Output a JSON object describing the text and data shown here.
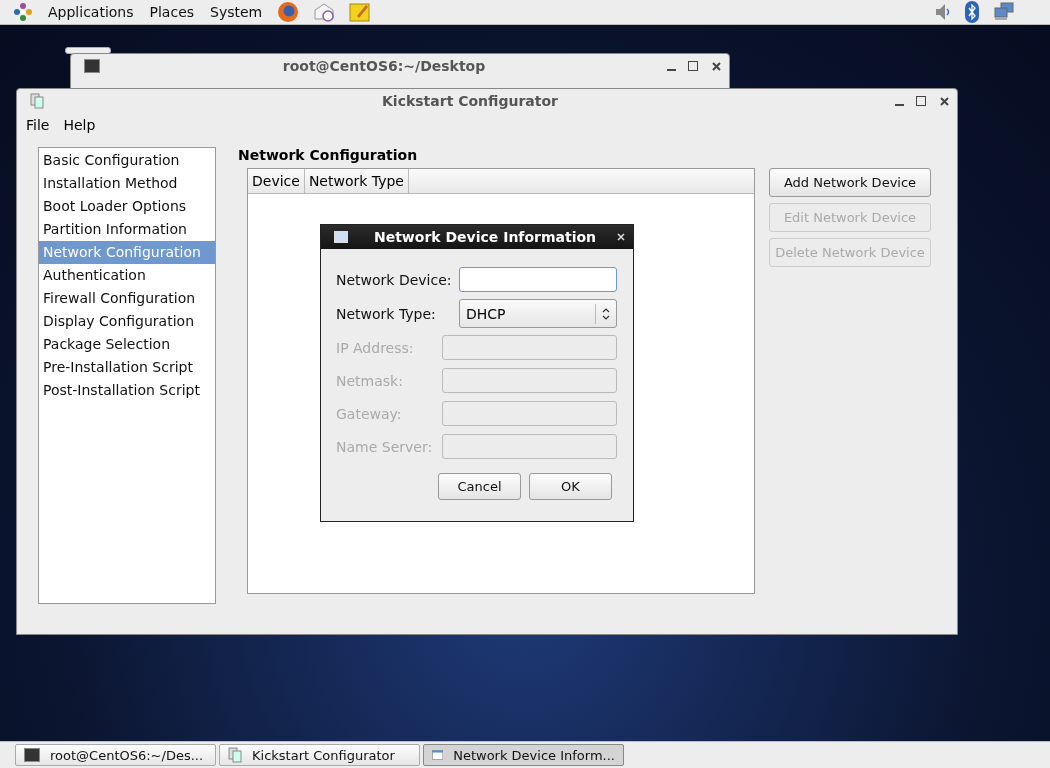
{
  "top_panel": {
    "menus": [
      "Applications",
      "Places",
      "System"
    ]
  },
  "terminal_window": {
    "title": "root@CentOS6:~/Desktop"
  },
  "main_window": {
    "title": "Kickstart Configurator",
    "menu": [
      "File",
      "Help"
    ],
    "sidebar": {
      "items": [
        {
          "label": "Basic Configuration",
          "selected": false
        },
        {
          "label": "Installation Method",
          "selected": false
        },
        {
          "label": "Boot Loader Options",
          "selected": false
        },
        {
          "label": "Partition Information",
          "selected": false
        },
        {
          "label": "Network Configuration",
          "selected": true
        },
        {
          "label": "Authentication",
          "selected": false
        },
        {
          "label": "Firewall Configuration",
          "selected": false
        },
        {
          "label": "Display Configuration",
          "selected": false
        },
        {
          "label": "Package Selection",
          "selected": false
        },
        {
          "label": "Pre-Installation Script",
          "selected": false
        },
        {
          "label": "Post-Installation Script",
          "selected": false
        }
      ]
    },
    "section_title": "Network Configuration",
    "table": {
      "columns": [
        "Device",
        "Network Type"
      ]
    },
    "buttons": [
      {
        "label": "Add Network Device",
        "disabled": false
      },
      {
        "label": "Edit Network Device",
        "disabled": true
      },
      {
        "label": "Delete Network Device",
        "disabled": true
      }
    ]
  },
  "dialog": {
    "title": "Network Device Information",
    "fields": [
      {
        "label": "Network Device:",
        "kind": "text",
        "disabled": false
      },
      {
        "label": "Network Type:",
        "kind": "select",
        "value": "DHCP",
        "disabled": false
      },
      {
        "label": "IP Address:",
        "kind": "text",
        "disabled": true
      },
      {
        "label": "Netmask:",
        "kind": "text",
        "disabled": true
      },
      {
        "label": "Gateway:",
        "kind": "text",
        "disabled": true
      },
      {
        "label": "Name Server:",
        "kind": "text",
        "disabled": true
      }
    ],
    "buttons": [
      "Cancel",
      "OK"
    ]
  },
  "taskbar": {
    "items": [
      {
        "label": "root@CentOS6:~/Des...",
        "kind": "terminal",
        "selected": false
      },
      {
        "label": "Kickstart Configurator",
        "kind": "app",
        "selected": false
      },
      {
        "label": "Network Device Inform...",
        "kind": "window",
        "selected": true
      }
    ]
  }
}
